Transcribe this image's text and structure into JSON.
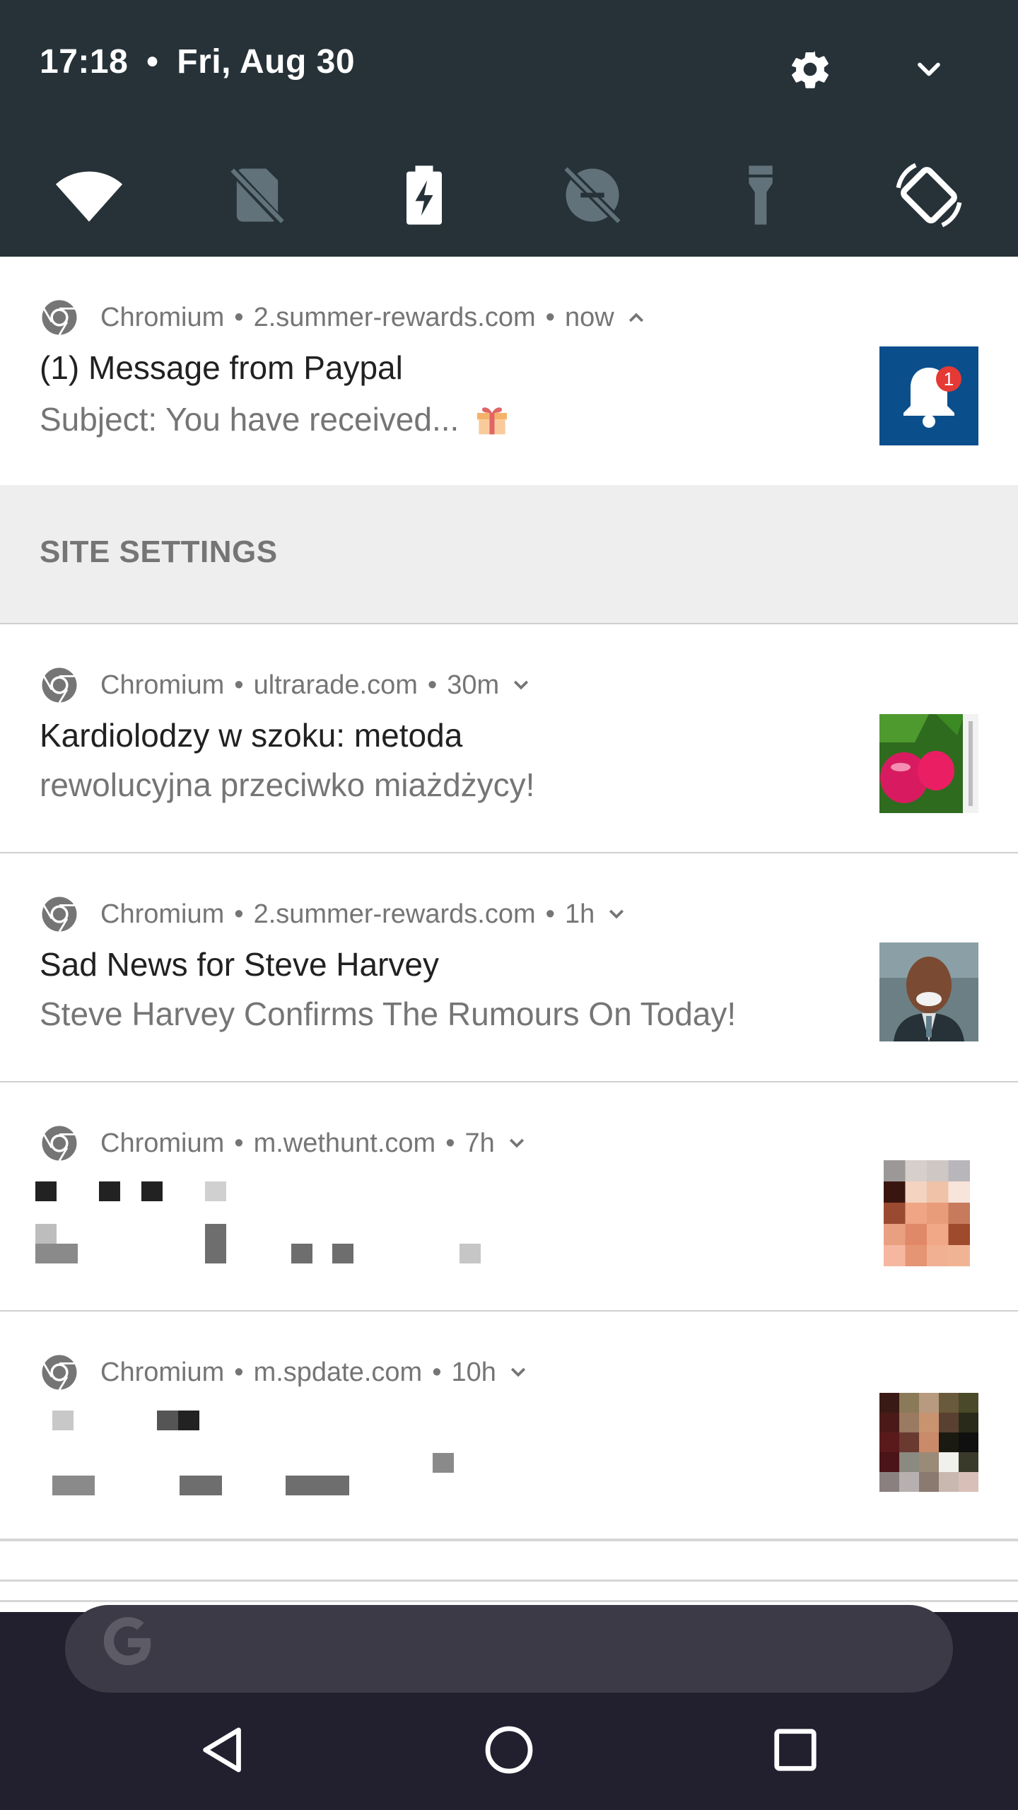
{
  "status": {
    "time": "17:18",
    "separator": "•",
    "date": "Fri, Aug 30"
  },
  "quick_tiles": [
    "wifi-icon",
    "no-sim-icon",
    "battery-charging-icon",
    "data-saver-off-icon",
    "flashlight-icon",
    "auto-rotate-icon"
  ],
  "notifications": [
    {
      "app": "Chromium",
      "site": "2.summer-rewards.com",
      "time": "now",
      "expanded": true,
      "title": "(1) Message from Paypal",
      "body": "Subject: You have received...",
      "badge": "1"
    },
    {
      "app": "Chromium",
      "site": "ultrarade.com",
      "time": "30m",
      "expanded": false,
      "title": "Kardiolodzy w szoku: metoda",
      "body": "rewolucyjna przeciwko miażdżycy!"
    },
    {
      "app": "Chromium",
      "site": "2.summer-rewards.com",
      "time": "1h",
      "expanded": false,
      "title": "Sad News for Steve Harvey",
      "body": "Steve Harvey Confirms The Rumours On Today!"
    },
    {
      "app": "Chromium",
      "site": "m.wethunt.com",
      "time": "7h",
      "expanded": false
    },
    {
      "app": "Chromium",
      "site": "m.spdate.com",
      "time": "10h",
      "expanded": false
    }
  ],
  "site_settings_label": "SITE SETTINGS",
  "colors": {
    "header_bg": "#263238",
    "accent_blue": "#0a4f8c",
    "badge_red": "#e53935",
    "home_bg": "#221f2f"
  }
}
